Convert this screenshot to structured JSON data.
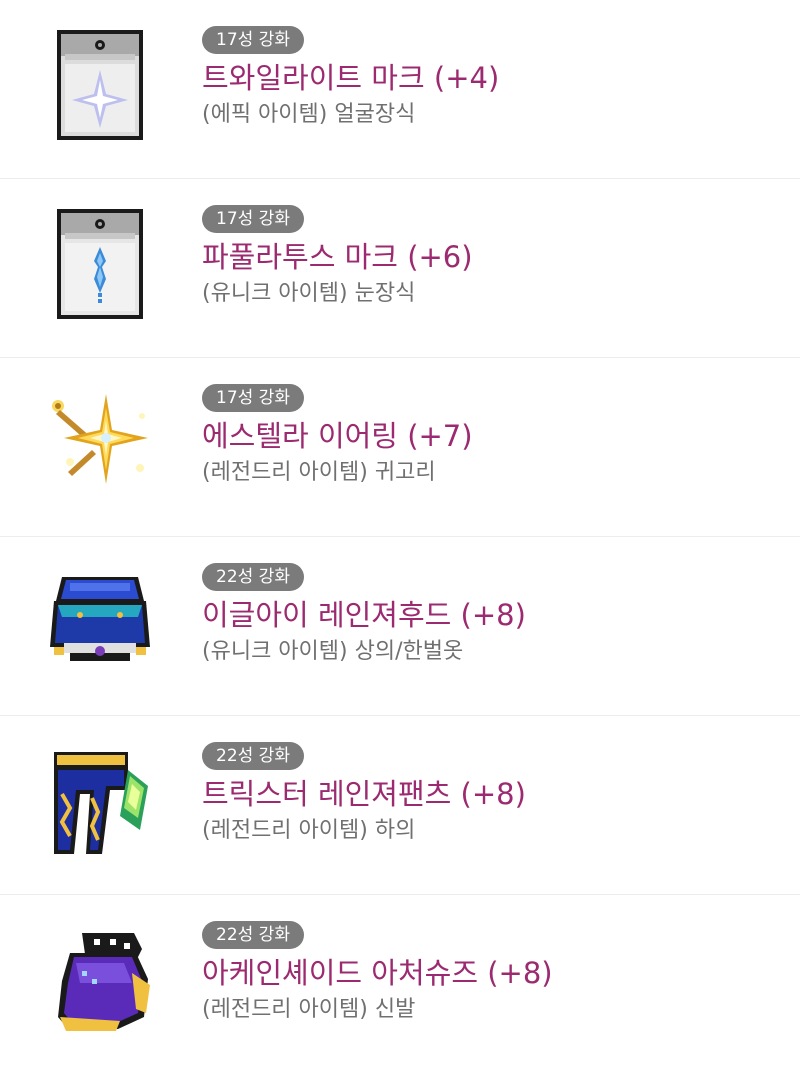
{
  "items": [
    {
      "badge": "17성 강화",
      "name": "트와일라이트 마크 (+4)",
      "sub": "(에픽 아이템) 얼굴장식",
      "icon": "twilight-mark-icon",
      "accent": "#7a7fd6"
    },
    {
      "badge": "17성 강화",
      "name": "파풀라투스 마크 (+6)",
      "sub": "(유니크 아이템) 눈장식",
      "icon": "papulatus-mark-icon",
      "accent": "#3b8bd9"
    },
    {
      "badge": "17성 강화",
      "name": "에스텔라 이어링 (+7)",
      "sub": "(레전드리 아이템) 귀고리",
      "icon": "estella-earring-icon",
      "accent": "#f0b323"
    },
    {
      "badge": "22성 강화",
      "name": "이글아이 레인져후드 (+8)",
      "sub": "(유니크 아이템) 상의/한벌옷",
      "icon": "eagle-eye-ranger-hood-icon",
      "accent": "#1d3aa8"
    },
    {
      "badge": "22성 강화",
      "name": "트릭스터 레인져팬츠 (+8)",
      "sub": "(레전드리 아이템) 하의",
      "icon": "trickster-ranger-pants-icon",
      "accent": "#1d2fa0"
    },
    {
      "badge": "22성 강화",
      "name": "아케인셰이드 아처슈즈 (+8)",
      "sub": "(레전드리 아이템) 신발",
      "icon": "arcane-umbra-archer-shoes-icon",
      "accent": "#5a2bb8"
    }
  ]
}
